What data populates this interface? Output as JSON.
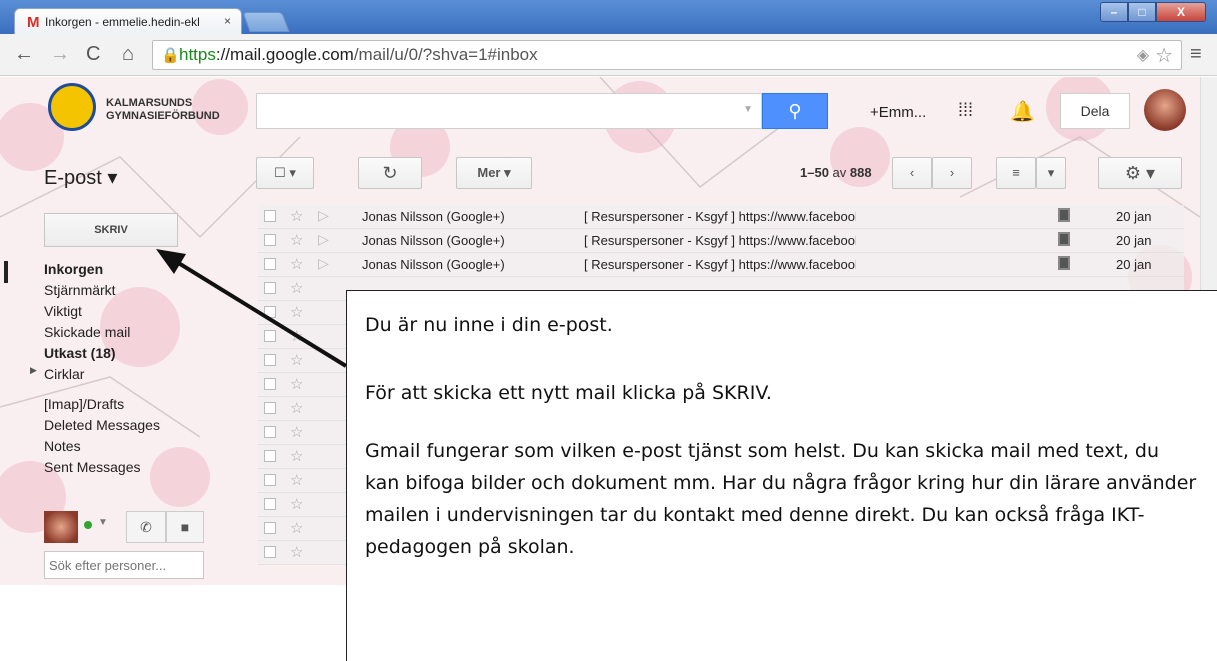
{
  "browser": {
    "tab_title": "Inkorgen - emmelie.hedin-ekl",
    "tab_close": "×",
    "url_scheme": "https",
    "url_host": "://mail.google.com",
    "url_path": "/mail/u/0/?shva=1#inbox",
    "win_min": "–",
    "win_max": "□",
    "win_close": "X"
  },
  "header": {
    "org_line1": "KALMARSUNDS",
    "org_line2": "GYMNASIEFÖRBUND",
    "user_name": "+Emm...",
    "share_label": "Dela"
  },
  "toolbar": {
    "mail_menu": "E-post ▾",
    "more_label": "Mer ▾",
    "page_range": "1–50",
    "page_of": "av",
    "page_total": "888"
  },
  "sidebar": {
    "compose_label": "SKRIV",
    "folders": [
      {
        "label": "Inkorgen"
      },
      {
        "label": "Stjärnmärkt"
      },
      {
        "label": "Viktigt"
      },
      {
        "label": "Skickade mail"
      },
      {
        "label": "Utkast (18)"
      },
      {
        "label": "Cirklar"
      },
      {
        "label": "[Imap]/Drafts"
      },
      {
        "label": "Deleted Messages"
      },
      {
        "label": "Notes"
      },
      {
        "label": "Sent Messages"
      }
    ],
    "people_search_placeholder": "Sök efter personer..."
  },
  "messages": [
    {
      "sender": "Jonas Nilsson (Google+)",
      "subject": "[ Resurspersoner - Ksgyf ] https://www.facebook.com/DigitalaCoach",
      "date": "20 jan"
    },
    {
      "sender": "Jonas Nilsson (Google+)",
      "subject": "[ Resurspersoner - Ksgyf ] https://www.facebook.com/pages/Digitala",
      "date": "20 jan"
    },
    {
      "sender": "Jonas Nilsson (Google+)",
      "subject": "[ Resurspersoner - Ksgyf ] https://www.facebook.com/pages/Digitala",
      "date": "20 jan"
    }
  ],
  "callout": {
    "p1": "Du är nu inne i din e-post.",
    "p2": "För att skicka ett nytt mail klicka på SKRIV.",
    "p3": "Gmail fungerar som vilken e-post tjänst som helst. Du kan skicka mail med text, du kan bifoga bilder och dokument mm. Har du några frågor kring hur din lärare använder mailen i undervisningen tar du kontakt med denne direkt. Du kan också fråga IKT-pedagogen på skolan."
  },
  "colors": {
    "accent_blue": "#4d90fe",
    "background_pink": "#f9eef0",
    "online_green": "#2ea52e"
  },
  "icons": [
    "gmail-icon",
    "lock-icon",
    "search-icon",
    "apps-grid-icon",
    "bell-icon",
    "refresh-icon",
    "gear-icon",
    "star-icon",
    "phone-icon",
    "video-icon"
  ]
}
